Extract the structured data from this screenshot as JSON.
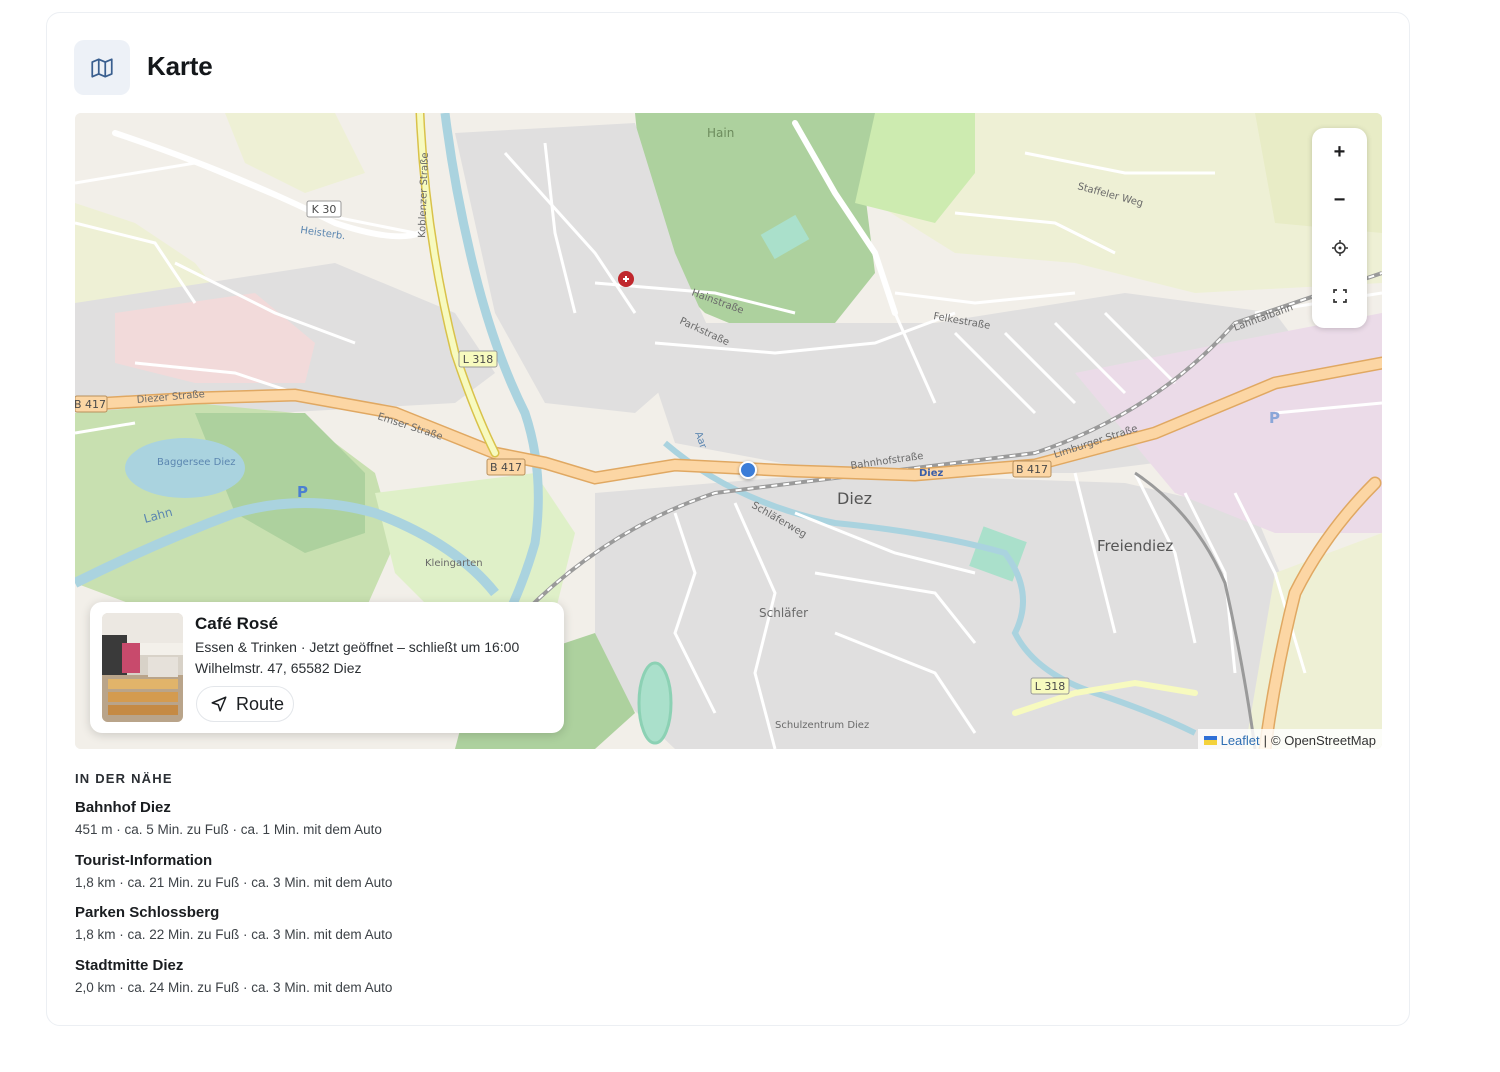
{
  "header": {
    "title": "Karte",
    "icon": "map-icon"
  },
  "map": {
    "attribution": {
      "leaflet": "Leaflet",
      "separator": "|",
      "osm": "© OpenStreetMap"
    },
    "controls": {
      "zoom_in": "+",
      "zoom_out": "−",
      "locate_icon": "crosshair-icon",
      "fullscreen_icon": "fullscreen-icon"
    },
    "labels": {
      "town_diez": "Diez",
      "town_freiendiez": "Freiendiez",
      "district_schlaefer": "Schläfer",
      "hain": "Hain",
      "baggersee": "Baggersee Diez",
      "kleingarten": "Kleingarten",
      "schulzentrum": "Schulzentrum Diez",
      "station_diez": "Diez",
      "diezer_strasse": "Diezer Straße",
      "emser_strasse": "Emser Straße",
      "limburger_strasse": "Limburger Straße",
      "bahnhofstrasse": "Bahnhofstraße",
      "koblenzer_strasse": "Koblenzer Straße",
      "hainstrasse": "Hainstraße",
      "parkstrasse": "Parkstraße",
      "schlaeferweg": "Schläferweg",
      "felkestrasse": "Felkestraße",
      "staffeler_weg": "Staffeler Weg",
      "lahntalbahn": "Lahntalbahn",
      "aar": "Aar",
      "lahn": "Lahn",
      "heisterb": "Heisterb."
    },
    "road_shields": [
      "K 30",
      "L 318",
      "B 417",
      "B 417",
      "B 417",
      "L 318"
    ],
    "colors": {
      "marker": "#3b7dd8",
      "main_road": "#fcd6a4",
      "forest": "#add19e",
      "water": "#aad3df",
      "residential": "#e0dfdf",
      "farmland": "#eef0d5"
    }
  },
  "place": {
    "name": "Café Rosé",
    "category": "Essen & Trinken",
    "status": "Jetzt geöffnet – schließt um 16:00",
    "meta_separator": "·",
    "address": "Wilhelmstr. 47, 65582 Diez",
    "route_label": "Route",
    "route_icon": "navigation-arrow-icon"
  },
  "nearby": {
    "heading": "IN DER NÄHE",
    "items": [
      {
        "name": "Bahnhof Diez",
        "info": "451 m · ca. 5 Min. zu Fuß · ca. 1 Min. mit dem Auto"
      },
      {
        "name": "Tourist-Information",
        "info": "1,8 km · ca. 21 Min. zu Fuß · ca. 3 Min. mit dem Auto"
      },
      {
        "name": "Parken Schlossberg",
        "info": "1,8 km · ca. 22 Min. zu Fuß · ca. 3 Min. mit dem Auto"
      },
      {
        "name": "Stadtmitte Diez",
        "info": "2,0 km · ca. 24 Min. zu Fuß · ca. 3 Min. mit dem Auto"
      }
    ]
  }
}
